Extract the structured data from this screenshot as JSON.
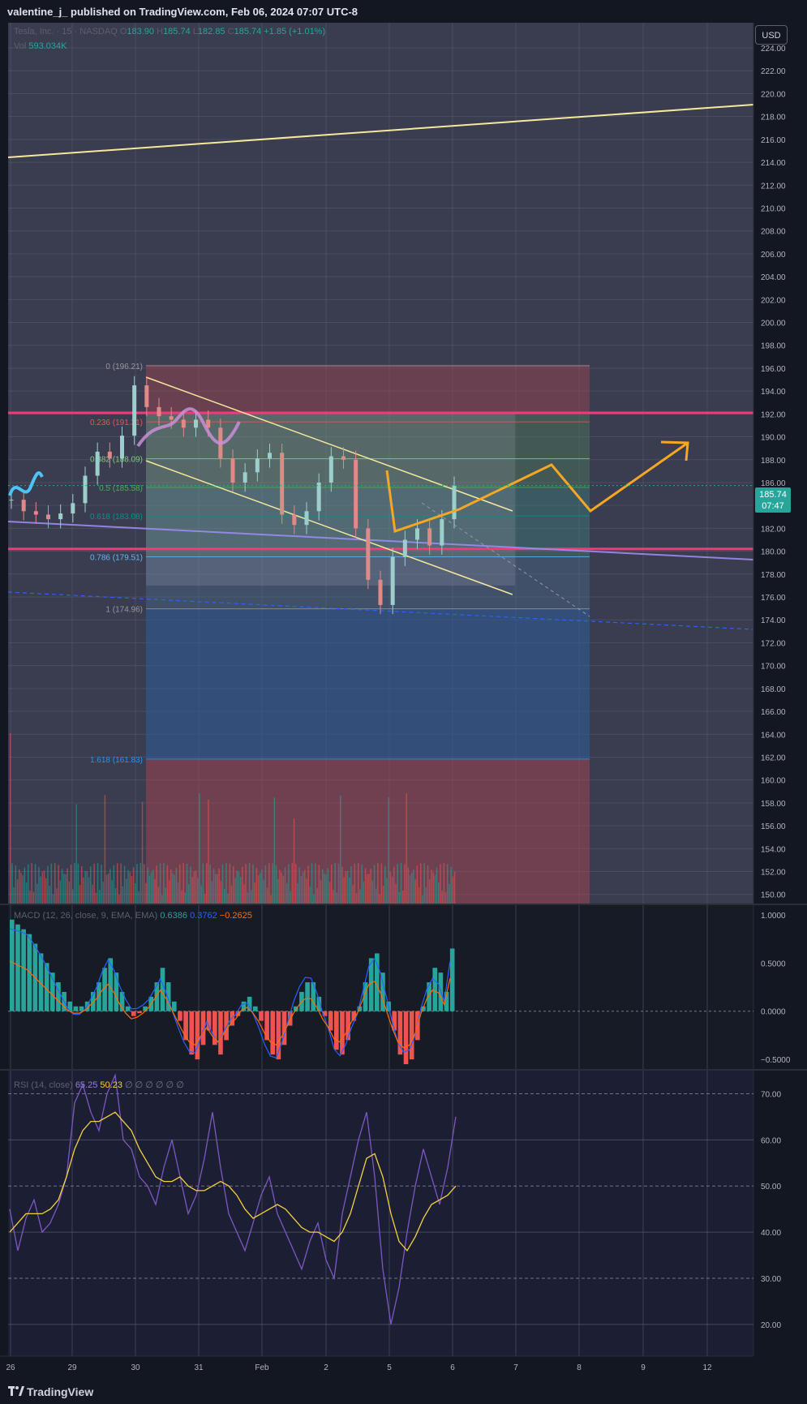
{
  "header": {
    "published": "valentine_j_ published on TradingView.com, Feb 06, 2024 07:07 UTC-8"
  },
  "footer": {
    "brand": "TradingView"
  },
  "currency_button": "USD",
  "last_price_tag": {
    "price": "185.74",
    "countdown": "07:47"
  },
  "legend_main": {
    "symbol": "Tesla, Inc. · 15 · NASDAQ",
    "o_label": "O",
    "o": "183.90",
    "h_label": "H",
    "h": "185.74",
    "l_label": "L",
    "l": "182.85",
    "c_label": "C",
    "c": "185.74",
    "change": "+1.85 (+1.01%)",
    "vol_label": "Vol",
    "vol": "593.034K"
  },
  "legend_macd": {
    "label": "MACD (12, 26, close, 9, EMA, EMA)",
    "hist": "0.6386",
    "macd": "0.3762",
    "signal": "−0.2625"
  },
  "legend_rsi": {
    "label": "RSI (14, close)",
    "rsi": "65.25",
    "ma": "50.23",
    "extra": "∅ ∅ ∅ ∅ ∅ ∅"
  },
  "fib_labels": [
    {
      "text": "0 (196.21)",
      "price": 196.21
    },
    {
      "text": "0.236 (191.31)",
      "price": 191.31
    },
    {
      "text": "0.382 (188.09)",
      "price": 188.09
    },
    {
      "text": "0.5 (185.58)",
      "price": 185.58
    },
    {
      "text": "0.618 (183.08)",
      "price": 183.08
    },
    {
      "text": "0.786 (179.51)",
      "price": 179.51
    },
    {
      "text": "1 (174.96)",
      "price": 174.96
    },
    {
      "text": "1.618 (161.83)",
      "price": 161.83
    }
  ],
  "colors": {
    "background": "#131722",
    "grid": "#2a2e39",
    "up": "#26a69a",
    "down": "#ef5350",
    "pink_line": "#f23a7a",
    "yellow_line": "#f5e99b",
    "orange_path": "#f5a623",
    "purple_line": "#9b8cf0",
    "rsi_line": "#7e57c2",
    "rsi_ma": "#f5d142",
    "macd_line": "#2962ff",
    "signal_line": "#ff6d00",
    "cyan_line": "#4fc3f7"
  },
  "chart_data": [
    {
      "type": "candlestick",
      "name_panel": "price",
      "ylim": [
        149,
        226
      ],
      "y_ticks": [
        "224.00",
        "222.00",
        "220.00",
        "218.00",
        "216.00",
        "214.00",
        "212.00",
        "210.00",
        "208.00",
        "206.00",
        "204.00",
        "202.00",
        "200.00",
        "198.00",
        "196.00",
        "194.00",
        "192.00",
        "190.00",
        "188.00",
        "186.00",
        "184.00",
        "182.00",
        "180.00",
        "178.00",
        "176.00",
        "174.00",
        "172.00",
        "170.00",
        "168.00",
        "166.00",
        "164.00",
        "162.00",
        "160.00",
        "158.00",
        "156.00",
        "154.00",
        "152.00",
        "150.00"
      ],
      "x_ticks": [
        "26",
        "29",
        "30",
        "31",
        "Feb",
        "2",
        "5",
        "6",
        "7",
        "8",
        "9",
        "12"
      ],
      "horizontal_levels": [
        192.1,
        180.2
      ],
      "approx_closes": [
        [
          26,
          184.5
        ],
        [
          26.5,
          183.5
        ],
        [
          27,
          183.2
        ],
        [
          27.5,
          182.8
        ],
        [
          28,
          183.3
        ],
        [
          28.4,
          184.2
        ],
        [
          28.8,
          186.6
        ],
        [
          29.2,
          188.7
        ],
        [
          29.6,
          188.1
        ],
        [
          30,
          190.1
        ],
        [
          30.2,
          194.5
        ],
        [
          30.5,
          192.6
        ],
        [
          30.8,
          191.8
        ],
        [
          31,
          191.5
        ],
        [
          31.5,
          190.8
        ],
        [
          31.8,
          191.5
        ],
        [
          32,
          190.8
        ],
        [
          32.3,
          188.1
        ],
        [
          32.6,
          186.0
        ],
        [
          33,
          186.9
        ],
        [
          33.4,
          188.1
        ],
        [
          33.8,
          188.6
        ],
        [
          34,
          183.2
        ],
        [
          34.5,
          182.3
        ],
        [
          35,
          183.5
        ],
        [
          35.5,
          186.0
        ],
        [
          35.8,
          188.3
        ],
        [
          36,
          188.0
        ],
        [
          36.1,
          182.0
        ],
        [
          36.2,
          177.5
        ],
        [
          36.4,
          175.3
        ],
        [
          36.7,
          179.5
        ],
        [
          37,
          181.0
        ],
        [
          37.4,
          182.0
        ],
        [
          37.7,
          180.5
        ],
        [
          38,
          182.8
        ],
        [
          38.2,
          185.74
        ]
      ]
    },
    {
      "type": "bar",
      "name_panel": "macd",
      "ylim": [
        -0.6,
        1.1
      ],
      "y_ticks": [
        "1.0000",
        "0.5000",
        "0.0000",
        "−0.5000"
      ],
      "values_histogram": [
        0.95,
        0.9,
        0.85,
        0.8,
        0.7,
        0.6,
        0.5,
        0.4,
        0.3,
        0.2,
        0.1,
        0.05,
        0.05,
        0.1,
        0.2,
        0.3,
        0.45,
        0.55,
        0.4,
        0.2,
        0.05,
        -0.05,
        -0.02,
        0.05,
        0.15,
        0.3,
        0.45,
        0.3,
        0.1,
        -0.1,
        -0.3,
        -0.45,
        -0.5,
        -0.35,
        -0.2,
        -0.35,
        -0.45,
        -0.3,
        -0.15,
        -0.05,
        0.1,
        0.15,
        0.05,
        -0.1,
        -0.3,
        -0.45,
        -0.5,
        -0.35,
        -0.15,
        0.05,
        0.2,
        0.3,
        0.3,
        0.15,
        -0.05,
        -0.2,
        -0.4,
        -0.45,
        -0.3,
        -0.1,
        0.05,
        0.3,
        0.55,
        0.6,
        0.4,
        0.1,
        -0.2,
        -0.45,
        -0.55,
        -0.5,
        -0.3,
        0.05,
        0.3,
        0.45,
        0.4,
        0.2,
        0.65
      ]
    },
    {
      "type": "line",
      "name_panel": "rsi",
      "ylim": [
        17,
        75
      ],
      "y_ticks": [
        "70.00",
        "60.00",
        "50.00",
        "40.00",
        "30.00",
        "20.00"
      ],
      "series": [
        {
          "name": "RSI",
          "values": [
            45,
            36,
            43,
            47,
            40,
            42,
            46,
            52,
            68,
            72,
            66,
            62,
            70,
            74,
            60,
            58,
            52,
            50,
            46,
            54,
            60,
            52,
            44,
            48,
            56,
            66,
            54,
            44,
            40,
            36,
            42,
            48,
            52,
            44,
            40,
            36,
            32,
            38,
            42,
            34,
            30,
            44,
            52,
            60,
            66,
            52,
            32,
            20,
            28,
            40,
            50,
            58,
            52,
            46,
            54,
            65
          ]
        },
        {
          "name": "MA",
          "values": [
            40,
            42,
            44,
            44,
            44,
            45,
            47,
            52,
            58,
            62,
            64,
            64,
            65,
            66,
            64,
            62,
            58,
            55,
            52,
            51,
            51,
            52,
            50,
            49,
            49,
            50,
            51,
            50,
            48,
            45,
            43,
            44,
            45,
            46,
            45,
            43,
            41,
            40,
            40,
            39,
            38,
            40,
            44,
            50,
            56,
            57,
            52,
            44,
            38,
            36,
            39,
            43,
            46,
            47,
            48,
            50
          ]
        }
      ]
    }
  ]
}
